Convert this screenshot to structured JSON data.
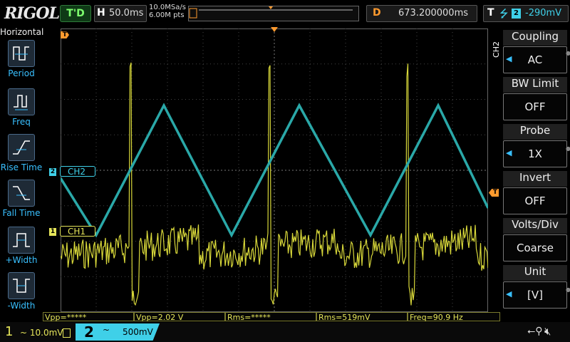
{
  "brand": "RIGOL",
  "status": "T'D",
  "horizontal": {
    "key": "H",
    "timebase": "50.0ms"
  },
  "sample_rate": "10.0MSa/s",
  "memory_depth": "6.00M pts",
  "delay": {
    "key": "D",
    "value": "673.200000ms"
  },
  "trigger": {
    "key": "T",
    "edge_icon": "falling-edge-icon",
    "source": "2",
    "level": "-290mV"
  },
  "left_menu": {
    "title": "Horizontal",
    "items": [
      {
        "label": "Period",
        "icon": "period-icon"
      },
      {
        "label": "Freq",
        "icon": "freq-icon"
      },
      {
        "label": "Rise Time",
        "icon": "rise-time-icon"
      },
      {
        "label": "Fall Time",
        "icon": "fall-time-icon"
      },
      {
        "label": "+Width",
        "icon": "pos-width-icon"
      },
      {
        "label": "-Width",
        "icon": "neg-width-icon"
      }
    ]
  },
  "right_menu": {
    "channel": "CH2",
    "items": [
      {
        "title": "Coupling",
        "value": "AC",
        "has_arrow": true
      },
      {
        "title": "BW Limit",
        "value": "OFF",
        "has_arrow": false
      },
      {
        "title": "Probe",
        "value": "1X",
        "has_arrow": true
      },
      {
        "title": "Invert",
        "value": "OFF",
        "has_arrow": false
      },
      {
        "title": "Volts/Div",
        "value": "Coarse",
        "has_arrow": false
      },
      {
        "title": "Unit",
        "value": "[V]",
        "has_arrow": true
      }
    ]
  },
  "markers": {
    "trigger": "T",
    "ch1": "1",
    "ch1_label": "CH1",
    "ch2": "2",
    "ch2_label": "CH2"
  },
  "measurements": [
    {
      "text": "Vpp=*****"
    },
    {
      "text": "Vpp=2.02 V"
    },
    {
      "text": "Rms=*****"
    },
    {
      "text": "Rms=519mV"
    },
    {
      "text": "Freq=90.9 Hz"
    }
  ],
  "ch1_status": {
    "number": "1",
    "scale": "~ 10.0mV"
  },
  "ch2_status": {
    "number": "2",
    "coupling": "~",
    "scale": "500mV"
  },
  "colors": {
    "ch1": "#e6e65a",
    "ch2": "#3fd0e8",
    "trigger": "#ff9a2e",
    "menu_text": "#39c0ff"
  }
}
